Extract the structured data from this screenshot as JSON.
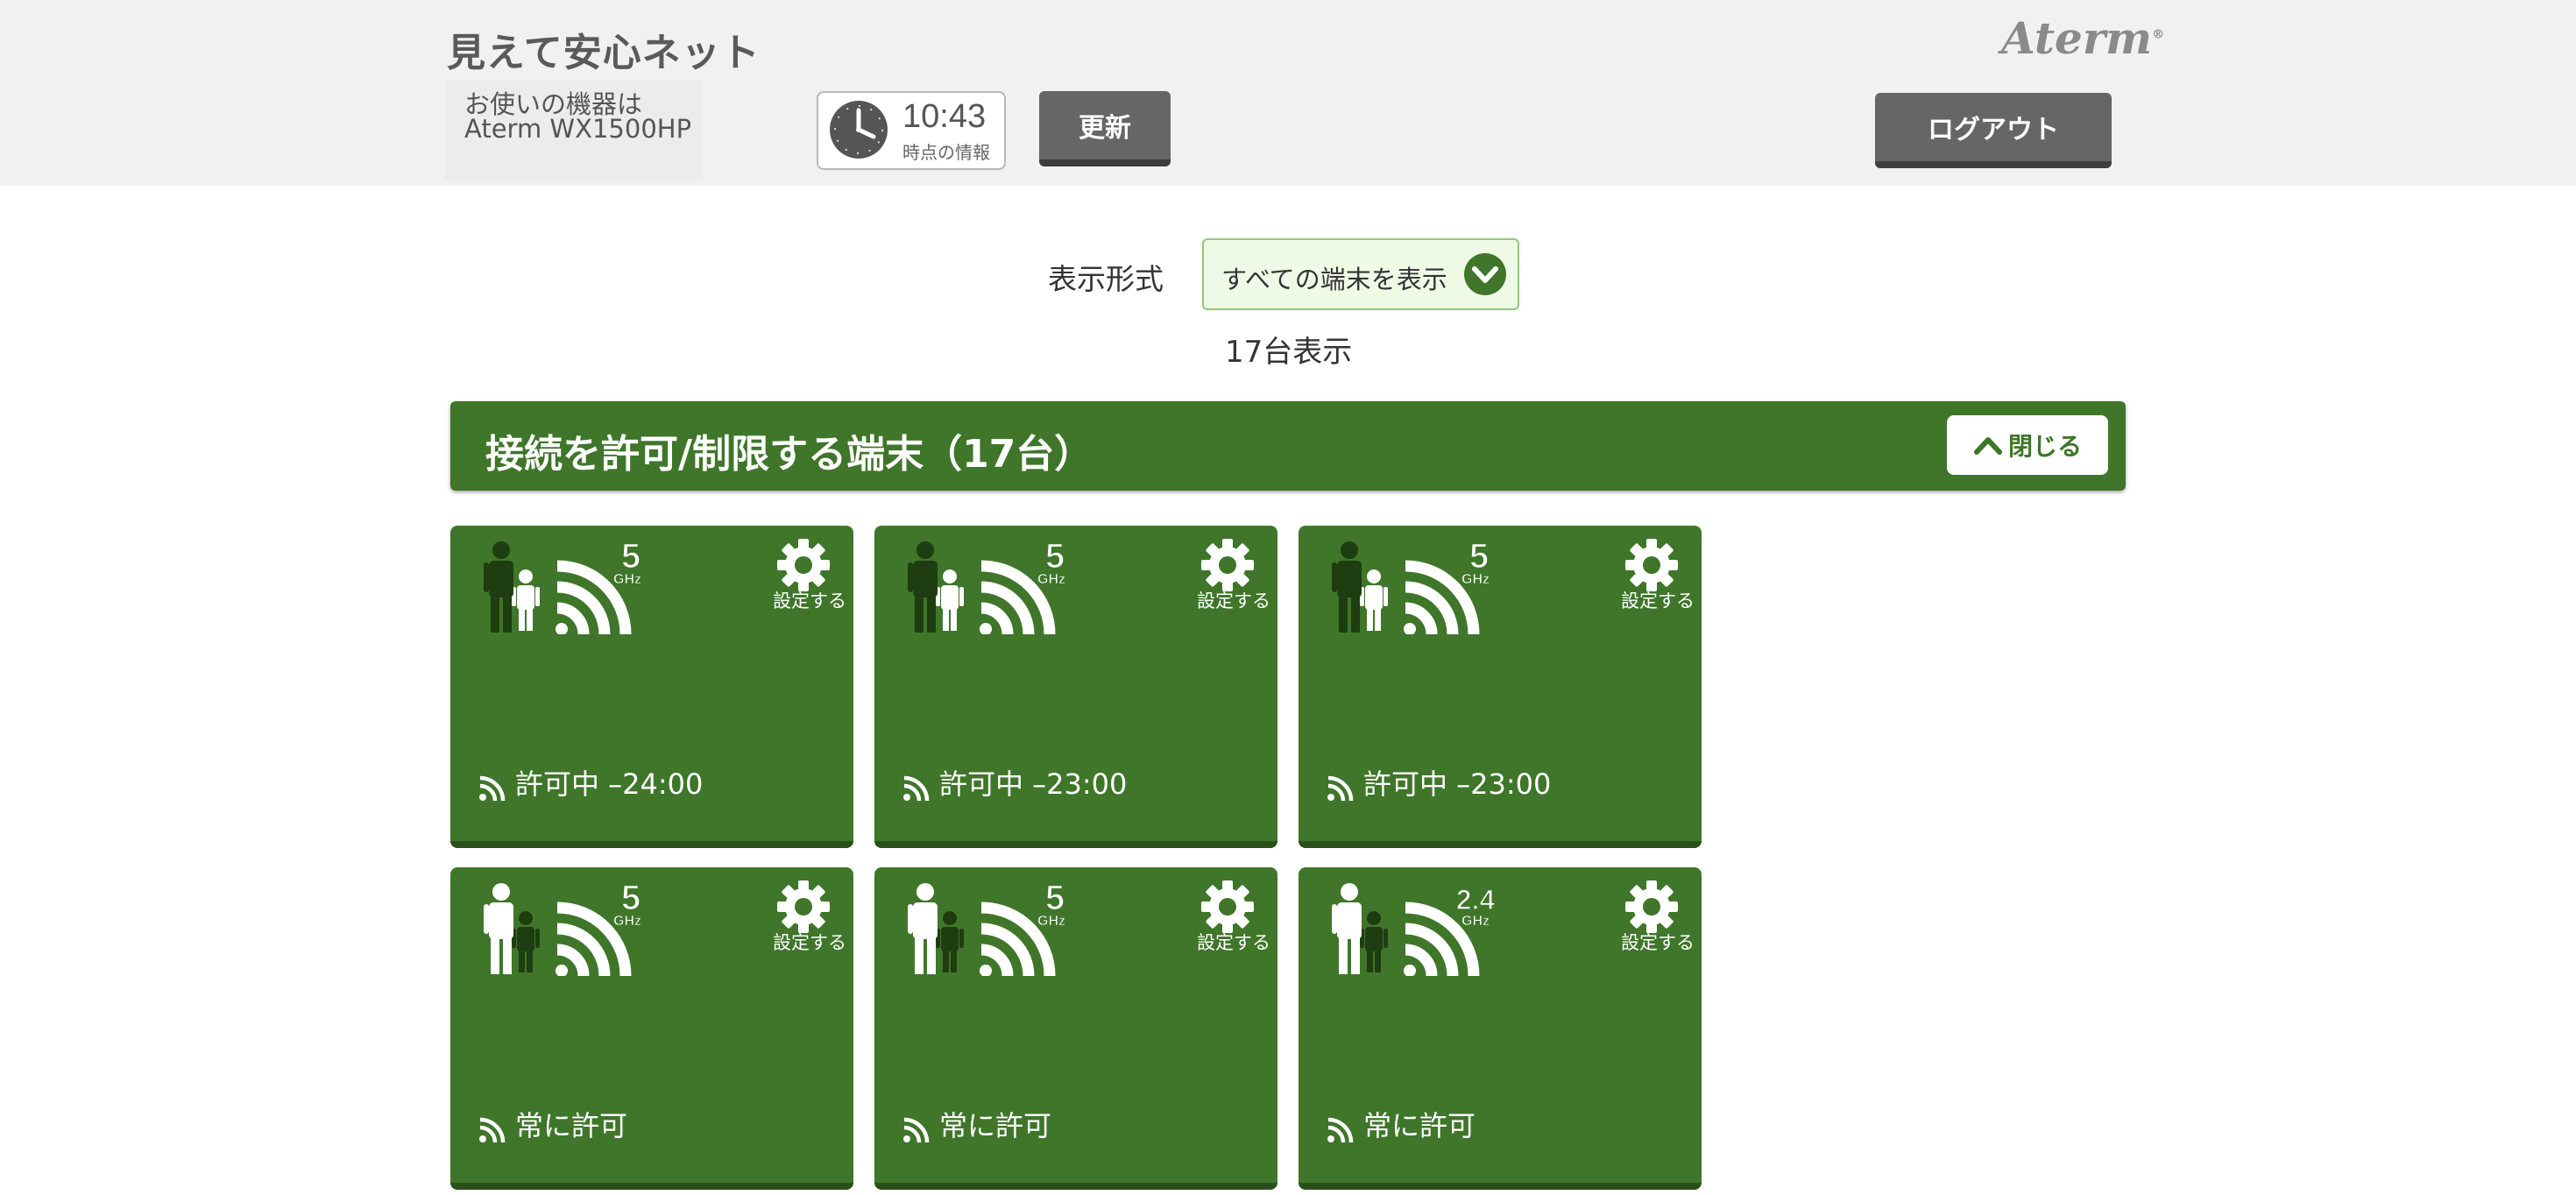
{
  "header": {
    "app_title": "見えて安心ネット",
    "device_label": "お使いの機器は",
    "device_name": "Aterm WX1500HP",
    "time": "10:43",
    "time_sub": "時点の情報",
    "refresh_label": "更新",
    "brand": "Aterm",
    "brand_mark": "®",
    "logout_label": "ログアウト"
  },
  "filter": {
    "label": "表示形式",
    "selected": "すべての端末を表示",
    "count_text": "17台表示"
  },
  "section": {
    "title": "接続を許可/制限する端末（17台）",
    "close_label": "閉じる"
  },
  "colors": {
    "card_green": "#3f762a",
    "header_bg": "#f1f1f1",
    "button_gray": "#666666"
  },
  "cards": [
    {
      "profile": "adult-child",
      "band": "5",
      "band_unit": "GHz",
      "settings_label": "設定する",
      "status": "許可中 –24:00"
    },
    {
      "profile": "adult-child",
      "band": "5",
      "band_unit": "GHz",
      "settings_label": "設定する",
      "status": "許可中 –23:00"
    },
    {
      "profile": "adult-child",
      "band": "5",
      "band_unit": "GHz",
      "settings_label": "設定する",
      "status": "許可中 –23:00"
    },
    {
      "profile": "adult",
      "band": "5",
      "band_unit": "GHz",
      "settings_label": "設定する",
      "status": "常に許可"
    },
    {
      "profile": "adult",
      "band": "5",
      "band_unit": "GHz",
      "settings_label": "設定する",
      "status": "常に許可"
    },
    {
      "profile": "adult",
      "band": "2.4",
      "band_unit": "GHz",
      "settings_label": "設定する",
      "status": "常に許可"
    }
  ]
}
